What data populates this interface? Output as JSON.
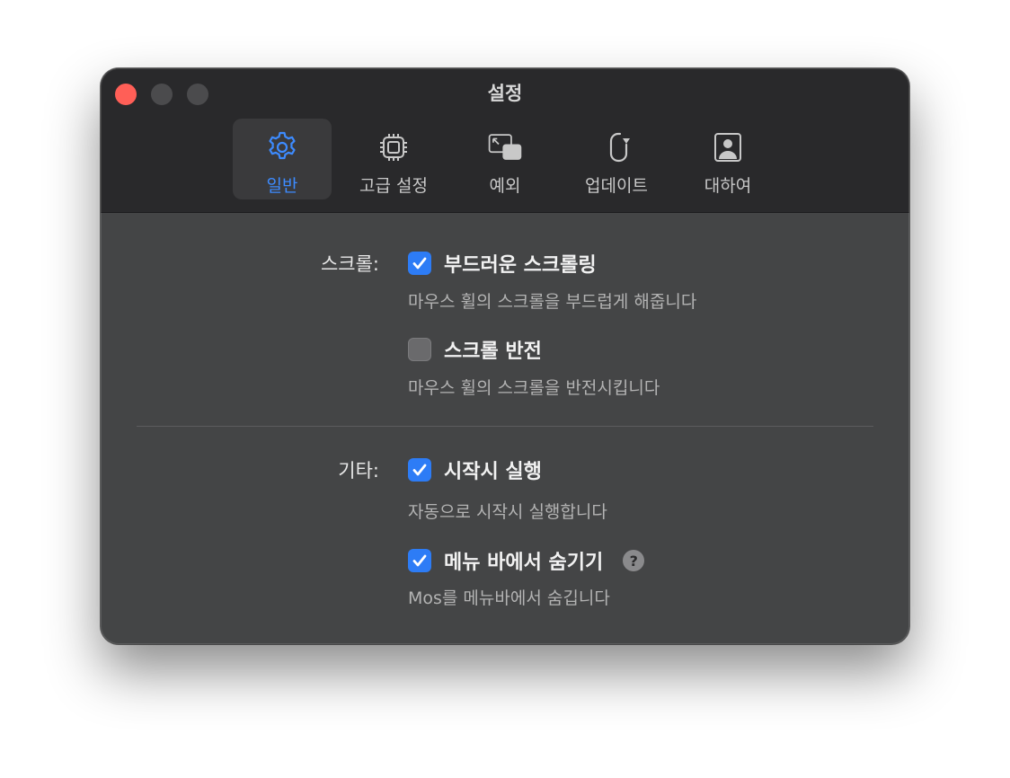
{
  "window": {
    "title": "설정"
  },
  "tabs": [
    {
      "label": "일반",
      "icon": "gear-icon",
      "active": true
    },
    {
      "label": "고급 설정",
      "icon": "chip-icon",
      "active": false
    },
    {
      "label": "예외",
      "icon": "window-exception-icon",
      "active": false
    },
    {
      "label": "업데이트",
      "icon": "update-icon",
      "active": false
    },
    {
      "label": "대하여",
      "icon": "person-icon",
      "active": false
    }
  ],
  "scroll": {
    "section_label": "스크롤:",
    "smooth": {
      "label": "부드러운 스크롤링",
      "checked": true,
      "description": "마우스 휠의 스크롤을 부드럽게 해줍니다"
    },
    "reverse": {
      "label": "스크롤 반전",
      "checked": false,
      "description": "마우스 휠의 스크롤을 반전시킵니다"
    }
  },
  "other": {
    "section_label": "기타:",
    "launch": {
      "label": "시작시 실행",
      "checked": true,
      "description": "자동으로 시작시 실행합니다"
    },
    "hide_menu": {
      "label": "메뉴 바에서 숨기기",
      "checked": true,
      "help": "?",
      "description": "Mos를 메뉴바에서 숨깁니다"
    }
  },
  "colors": {
    "accent": "#2d7cf6",
    "close": "#ff5f57"
  }
}
